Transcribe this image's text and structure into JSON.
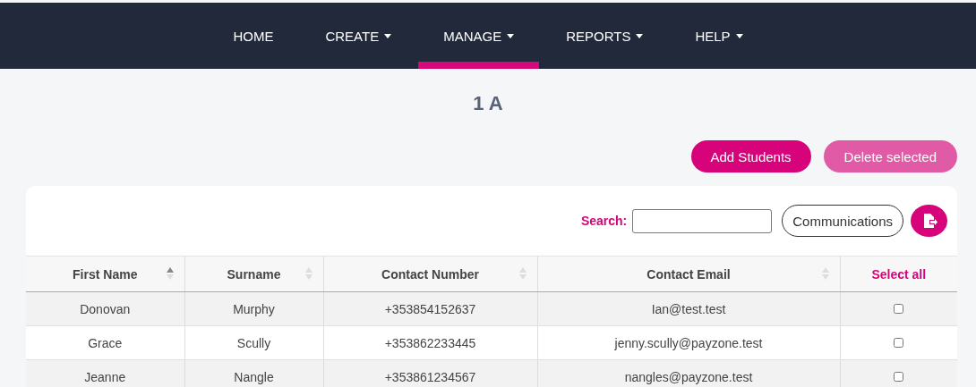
{
  "nav": [
    {
      "label": "HOME",
      "dropdown": false,
      "selected": false
    },
    {
      "label": "CREATE",
      "dropdown": true,
      "selected": false
    },
    {
      "label": "MANAGE",
      "dropdown": true,
      "selected": true
    },
    {
      "label": "REPORTS",
      "dropdown": true,
      "selected": false
    },
    {
      "label": "HELP",
      "dropdown": true,
      "selected": false
    }
  ],
  "title": "1 A",
  "actions": [
    {
      "label": "Add Students",
      "disabled": false
    },
    {
      "label": "Delete selected",
      "disabled": true
    }
  ],
  "search": {
    "label": "Search:"
  },
  "communications": "Communications",
  "table": {
    "columns": [
      {
        "label": "First Name",
        "sortable": true,
        "sorted": true
      },
      {
        "label": "Surname",
        "sortable": true,
        "sorted": false
      },
      {
        "label": "Contact Number",
        "sortable": true,
        "sorted": false
      },
      {
        "label": "Contact Email",
        "sortable": true,
        "sorted": false
      },
      {
        "label": "Select all",
        "sortable": false
      }
    ],
    "rows": [
      {
        "cells": [
          "Donovan",
          "Murphy",
          "+353854152637",
          "Ian@test.test"
        ],
        "checked": false
      },
      {
        "cells": [
          "Grace",
          "Scully",
          "+353862233445",
          "jenny.scully@payzone.test"
        ],
        "checked": false
      },
      {
        "cells": [
          "Jeanne",
          "Nangle",
          "+353861234567",
          "nangles@payzone.test"
        ],
        "checked": false
      }
    ]
  }
}
